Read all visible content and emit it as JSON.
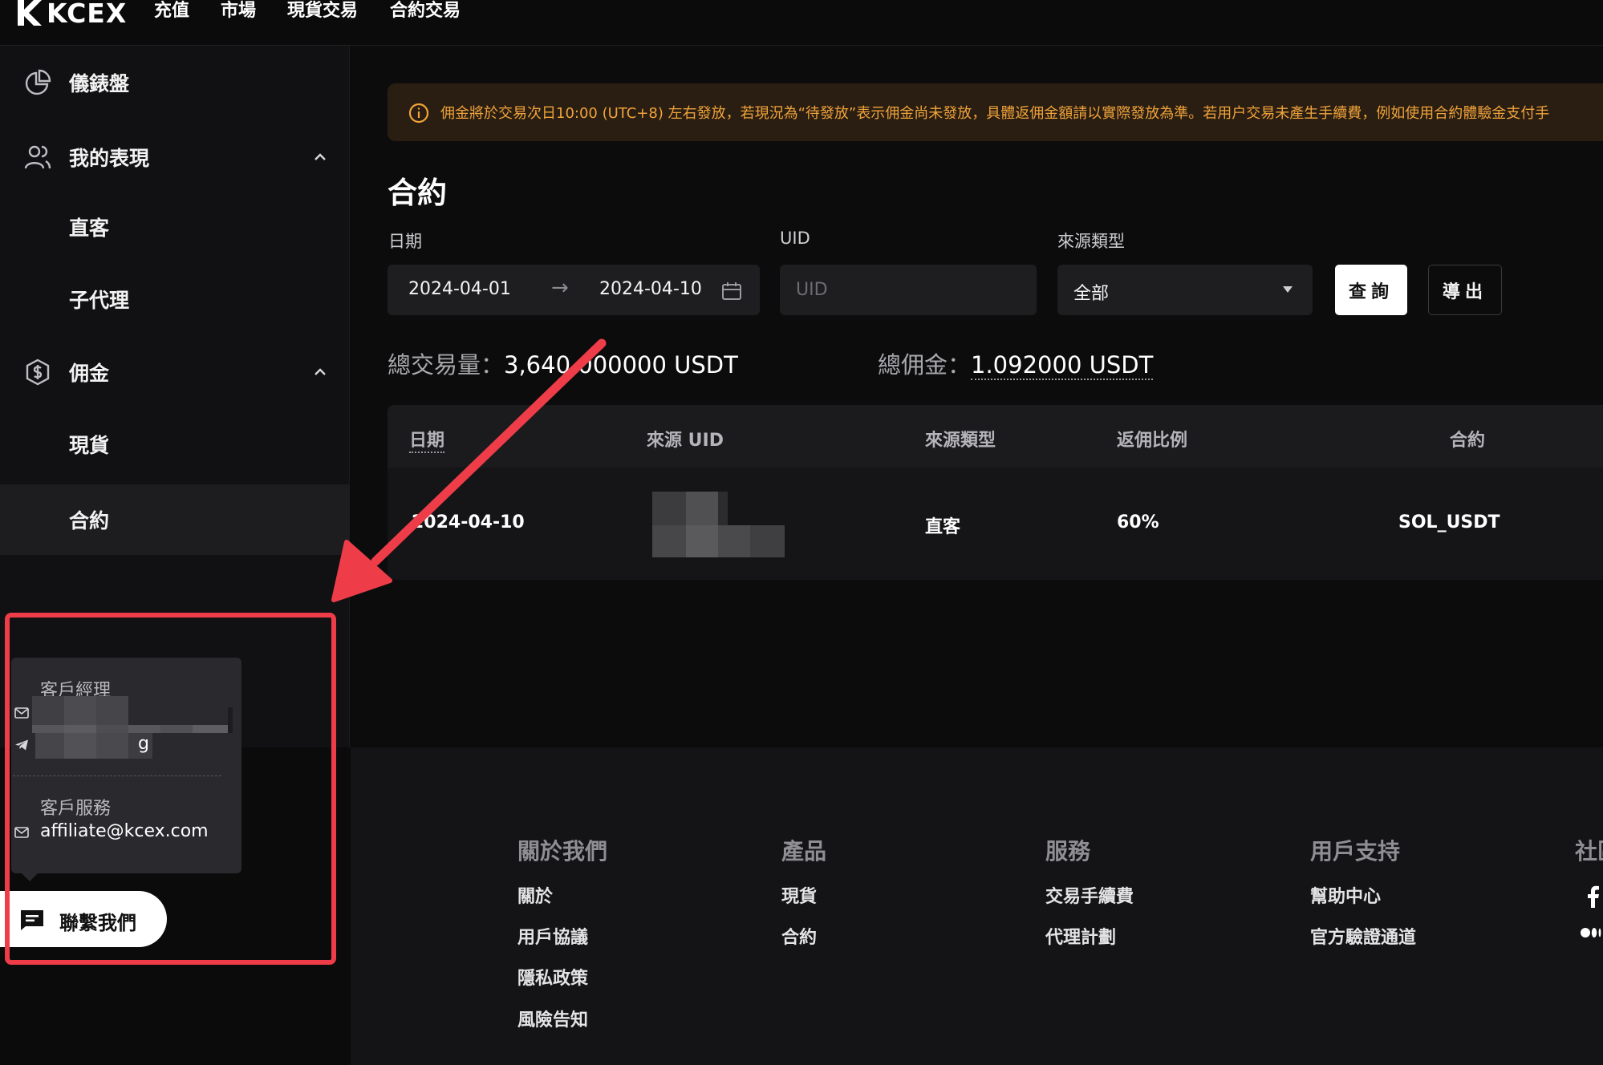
{
  "brand": {
    "name": "KCEX"
  },
  "topnav": {
    "items": [
      "充值",
      "市場",
      "現貨交易",
      "合約交易"
    ]
  },
  "sidebar": {
    "items": [
      {
        "label": "儀錶盤",
        "icon": "pie-chart-icon"
      },
      {
        "label": "我的表現",
        "icon": "users-icon",
        "expanded": true
      },
      {
        "label": "直客"
      },
      {
        "label": "子代理"
      },
      {
        "label": "佣金",
        "icon": "dollar-shield-icon",
        "expanded": true
      },
      {
        "label": "現貨"
      },
      {
        "label": "合約",
        "active": true
      }
    ]
  },
  "notice": {
    "text": "佣金將於交易次日10:00 (UTC+8) 左右發放，若現況為“待發放”表示佣金尚未發放，具體返佣金額請以實際發放為準。若用户交易未產生手續費，例如使用合約體驗金支付手"
  },
  "page": {
    "title": "合約"
  },
  "filters": {
    "date_label": "日期",
    "date_start": "2024-04-01",
    "date_end": "2024-04-10",
    "uid_label": "UID",
    "uid_placeholder": "UID",
    "source_label": "來源類型",
    "source_value": "全部",
    "query_label": "查詢",
    "export_label": "導出"
  },
  "summary": {
    "volume_label": "總交易量：",
    "volume_value": "3,640.000000 USDT",
    "commission_label": "總佣金：",
    "commission_value": "1.092000 USDT"
  },
  "table": {
    "columns": [
      "日期",
      "來源 UID",
      "來源類型",
      "返佣比例",
      "合約"
    ],
    "rows": [
      {
        "date": "2024-04-10",
        "uid": "",
        "source_type": "直客",
        "ratio": "60%",
        "contract": "SOL_USDT"
      }
    ]
  },
  "contact_popup": {
    "manager_title": "客戶經理",
    "manager_suffix": "g",
    "service_title": "客戶服務",
    "service_email": "affiliate@kcex.com"
  },
  "contact_button": {
    "label": "聯繫我們"
  },
  "footer": {
    "columns": [
      {
        "title": "關於我們",
        "links": [
          "關於",
          "用戶協議",
          "隱私政策",
          "風險告知"
        ]
      },
      {
        "title": "產品",
        "links": [
          "現貨",
          "合約"
        ]
      },
      {
        "title": "服務",
        "links": [
          "交易手續費",
          "代理計劃"
        ]
      },
      {
        "title": "用戶支持",
        "links": [
          "幫助中心",
          "官方驗證通道"
        ]
      },
      {
        "title": "社區",
        "links": []
      }
    ]
  },
  "colors": {
    "accent_warning": "#f0a33a",
    "annotation_red": "#ee3d48",
    "background": "#0b0b0c"
  }
}
